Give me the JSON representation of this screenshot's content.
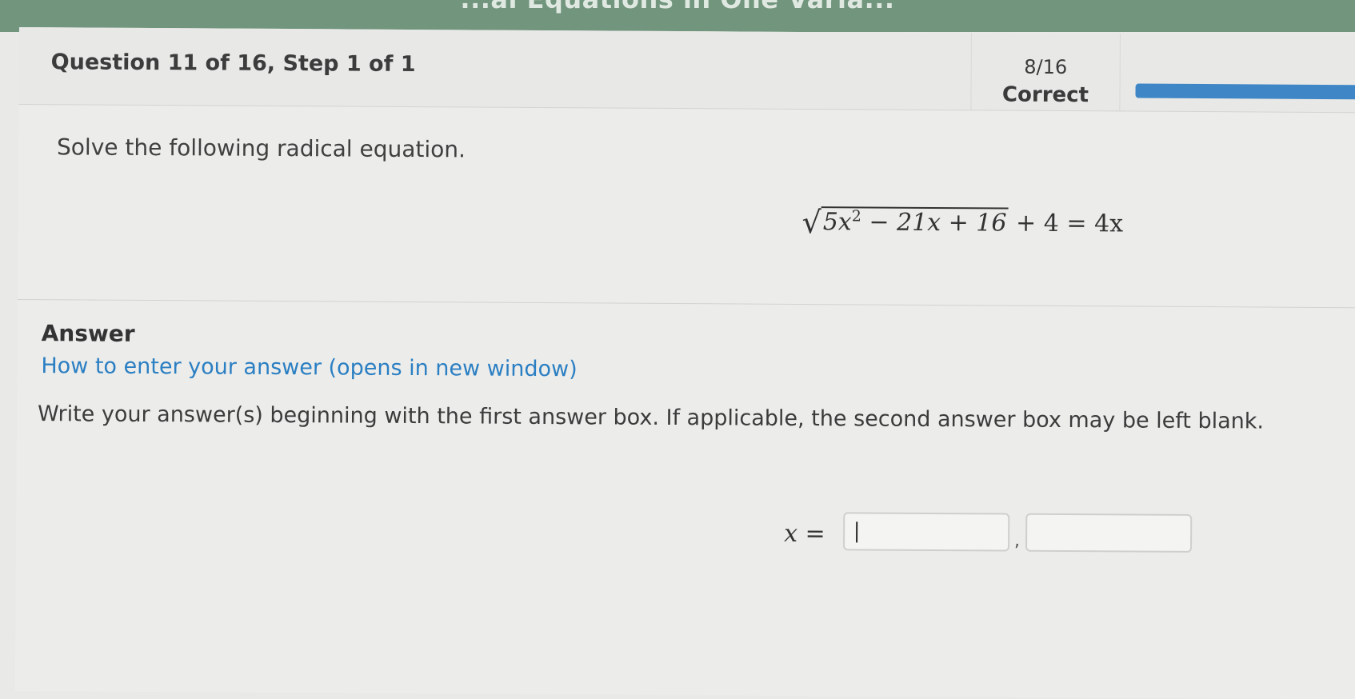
{
  "topbar": {
    "title": "...al Equations in One Varia..."
  },
  "header": {
    "question_label": "Question 11 of 16, Step 1 of 1",
    "score_count": "8/16",
    "score_label": "Correct",
    "progress_fraction": 0.5,
    "progress_color": "#3f86c6"
  },
  "question": {
    "instruction": "Solve the following radical equation.",
    "equation": {
      "radical_symbol": "√",
      "radicand_coef": "5x",
      "radicand_exp": "2",
      "radicand_rest": " − 21x + 16",
      "rest": " + 4 = 4x"
    }
  },
  "answer": {
    "heading": "Answer",
    "help_link": "How to enter your answer (opens in new window)",
    "instruction": "Write your answer(s) beginning with the first answer box. If applicable, the second answer box may be left blank.",
    "variable_label": "x =",
    "separator": ",",
    "box1_value": "",
    "box2_value": ""
  }
}
